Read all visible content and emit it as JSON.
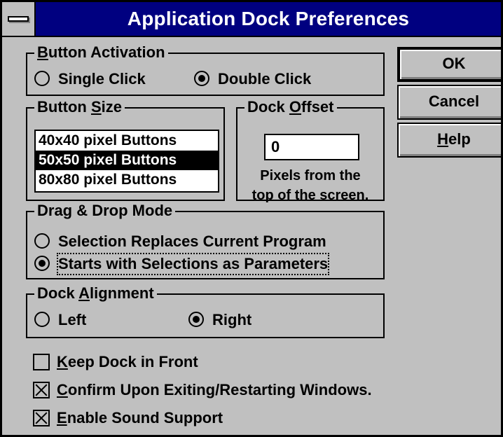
{
  "window": {
    "title": "Application Dock Preferences"
  },
  "button_activation": {
    "legend_pre": "",
    "legend_u": "B",
    "legend_post": "utton Activation",
    "options": [
      {
        "label": "Single Click",
        "selected": false
      },
      {
        "label": "Double Click",
        "selected": true
      }
    ]
  },
  "button_size": {
    "legend_pre": "Button ",
    "legend_u": "S",
    "legend_post": "ize",
    "items": [
      "40x40 pixel Buttons",
      "50x50 pixel Buttons",
      "80x80 pixel Buttons"
    ],
    "selected": "50x50 pixel Buttons"
  },
  "dock_offset": {
    "legend_pre": "Dock ",
    "legend_u": "O",
    "legend_post": "ffset",
    "value": "0",
    "note_line1": "Pixels from the",
    "note_line2": "top of the screen."
  },
  "drag_drop": {
    "legend": "Drag & Drop Mode",
    "options": [
      {
        "label": "Selection Replaces Current Program",
        "selected": false
      },
      {
        "label": "Starts with Selections as Parameters",
        "selected": true
      }
    ]
  },
  "dock_alignment": {
    "legend_pre": "Dock ",
    "legend_u": "A",
    "legend_post": "lignment",
    "options": [
      {
        "label": "Left",
        "selected": false
      },
      {
        "label": "Right",
        "selected": true
      }
    ]
  },
  "checkboxes": [
    {
      "u": "K",
      "rest": "eep Dock in Front",
      "checked": false
    },
    {
      "u": "C",
      "rest": "onfirm Upon Exiting/Restarting Windows.",
      "checked": true
    },
    {
      "u": "E",
      "rest": "nable Sound Support",
      "checked": true
    }
  ],
  "buttons": {
    "ok": "OK",
    "cancel": "Cancel",
    "help_u": "H",
    "help_rest": "elp"
  }
}
